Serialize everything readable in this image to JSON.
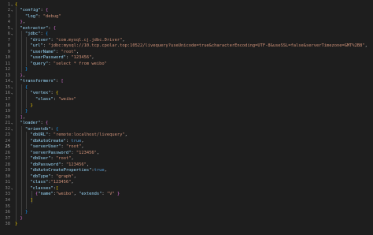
{
  "editor": {
    "lines": [
      {
        "n": "1",
        "segs": [
          [
            "{",
            "b1"
          ]
        ]
      },
      {
        "n": "2",
        "segs": [
          [
            "  ",
            ""
          ],
          [
            "\"config\"",
            "t-key"
          ],
          [
            ": ",
            "t-p"
          ],
          [
            "{",
            "b2"
          ]
        ]
      },
      {
        "n": "3",
        "segs": [
          [
            "    ",
            ""
          ],
          [
            "\"log\"",
            "t-key"
          ],
          [
            ": ",
            "t-p"
          ],
          [
            "\"debug\"",
            "t-str"
          ]
        ]
      },
      {
        "n": "4",
        "segs": [
          [
            "  ",
            ""
          ],
          [
            "}",
            "b2"
          ],
          [
            ",",
            "t-p"
          ]
        ]
      },
      {
        "n": "5",
        "segs": [
          [
            "  ",
            ""
          ],
          [
            "\"extractor\"",
            "t-key"
          ],
          [
            ": ",
            "t-p"
          ],
          [
            "{",
            "b2"
          ]
        ]
      },
      {
        "n": "6",
        "segs": [
          [
            "    ",
            ""
          ],
          [
            "\"jdbc\"",
            "t-key"
          ],
          [
            ": ",
            "t-p"
          ],
          [
            "{",
            "b3"
          ]
        ]
      },
      {
        "n": "7",
        "segs": [
          [
            "      ",
            ""
          ],
          [
            "\"driver\"",
            "t-key"
          ],
          [
            ": ",
            "t-p"
          ],
          [
            "\"com.mysql.cj.jdbc.Driver\"",
            "t-str"
          ],
          [
            ",",
            "t-p"
          ]
        ]
      },
      {
        "n": "8",
        "segs": [
          [
            "      ",
            ""
          ],
          [
            "\"url\"",
            "t-key"
          ],
          [
            ": ",
            "t-p"
          ],
          [
            "\"jdbc:mysql://10.tcp.cpolar.top:10522/livequery?useUnicode=true&characterEncoding=UTF-8&useSSL=false&serverTimezone=GMT%2B8\"",
            "t-str"
          ],
          [
            ",",
            "t-p"
          ]
        ]
      },
      {
        "n": "9",
        "segs": [
          [
            "      ",
            ""
          ],
          [
            "\"userName\"",
            "t-key"
          ],
          [
            ": ",
            "t-p"
          ],
          [
            "\"root\"",
            "t-str"
          ],
          [
            ",",
            "t-p"
          ]
        ]
      },
      {
        "n": "10",
        "segs": [
          [
            "      ",
            ""
          ],
          [
            "\"userPassword\"",
            "t-key"
          ],
          [
            ": ",
            "t-p"
          ],
          [
            "\"123456\"",
            "t-str"
          ],
          [
            ",",
            "t-p"
          ]
        ]
      },
      {
        "n": "11",
        "segs": [
          [
            "      ",
            ""
          ],
          [
            "\"query\"",
            "t-key"
          ],
          [
            ": ",
            "t-p"
          ],
          [
            "\"select * from weibo\"",
            "t-str"
          ]
        ]
      },
      {
        "n": "12",
        "segs": [
          [
            "    ",
            ""
          ],
          [
            "}",
            "b3"
          ]
        ]
      },
      {
        "n": "13",
        "segs": [
          [
            "  ",
            ""
          ],
          [
            "}",
            "b2"
          ],
          [
            ",",
            "t-p"
          ]
        ]
      },
      {
        "n": "14",
        "segs": [
          [
            "  ",
            ""
          ],
          [
            "\"transformers\"",
            "t-key"
          ],
          [
            ": ",
            "t-p"
          ],
          [
            "[",
            "b2"
          ]
        ]
      },
      {
        "n": "15",
        "segs": [
          [
            "    ",
            ""
          ],
          [
            "{",
            "b3"
          ]
        ]
      },
      {
        "n": "16",
        "segs": [
          [
            "      ",
            ""
          ],
          [
            "\"vertex\"",
            "t-key"
          ],
          [
            ": ",
            "t-p"
          ],
          [
            "{",
            "b1"
          ]
        ]
      },
      {
        "n": "17",
        "segs": [
          [
            "        ",
            ""
          ],
          [
            "\"class\"",
            "t-key"
          ],
          [
            ": ",
            "t-p"
          ],
          [
            "\"weibo\"",
            "t-str"
          ]
        ]
      },
      {
        "n": "18",
        "segs": [
          [
            "      ",
            ""
          ],
          [
            "}",
            "b1"
          ]
        ]
      },
      {
        "n": "19",
        "segs": [
          [
            "    ",
            ""
          ],
          [
            "}",
            "b3"
          ]
        ]
      },
      {
        "n": "20",
        "segs": [
          [
            "  ",
            ""
          ],
          [
            "]",
            "b2"
          ],
          [
            ",",
            "t-p"
          ]
        ]
      },
      {
        "n": "21",
        "segs": [
          [
            "  ",
            ""
          ],
          [
            "\"loader\"",
            "t-key"
          ],
          [
            ": ",
            "t-p"
          ],
          [
            "{",
            "b2"
          ]
        ]
      },
      {
        "n": "22",
        "segs": [
          [
            "    ",
            ""
          ],
          [
            "\"orientdb\"",
            "t-key"
          ],
          [
            ": ",
            "t-p"
          ],
          [
            "{",
            "b3"
          ]
        ]
      },
      {
        "n": "23",
        "segs": [
          [
            "      ",
            ""
          ],
          [
            "\"dbURL\"",
            "t-key"
          ],
          [
            ": ",
            "t-p"
          ],
          [
            "\"remote:localhost/livequery\"",
            "t-str"
          ],
          [
            ",",
            "t-p"
          ]
        ]
      },
      {
        "n": "24",
        "segs": [
          [
            "      ",
            ""
          ],
          [
            "\"dbAutoCreate\"",
            "t-key"
          ],
          [
            ": ",
            "t-p"
          ],
          [
            "true",
            "t-kw"
          ],
          [
            ",",
            "t-p"
          ]
        ]
      },
      {
        "n": "25",
        "segs": [
          [
            "      ",
            ""
          ],
          [
            "\"serverUser\"",
            "t-key"
          ],
          [
            ": ",
            "t-p"
          ],
          [
            "\"root\"",
            "t-str"
          ],
          [
            ",",
            "t-p"
          ]
        ]
      },
      {
        "n": "26",
        "segs": [
          [
            "      ",
            ""
          ],
          [
            "\"serverPassword\"",
            "t-key"
          ],
          [
            ": ",
            "t-p"
          ],
          [
            "\"123456\"",
            "t-str"
          ],
          [
            ",",
            "t-p"
          ]
        ]
      },
      {
        "n": "27",
        "segs": [
          [
            "      ",
            ""
          ],
          [
            "\"dbUser\"",
            "t-key"
          ],
          [
            ": ",
            "t-p"
          ],
          [
            "\"root\"",
            "t-str"
          ],
          [
            ",",
            "t-p"
          ]
        ]
      },
      {
        "n": "28",
        "segs": [
          [
            "      ",
            ""
          ],
          [
            "\"dbPassword\"",
            "t-key"
          ],
          [
            ": ",
            "t-p"
          ],
          [
            "\"123456\"",
            "t-str"
          ],
          [
            ",",
            "t-p"
          ]
        ]
      },
      {
        "n": "29",
        "segs": [
          [
            "      ",
            ""
          ],
          [
            "\"dbAutoCreateProperties\"",
            "t-key"
          ],
          [
            ":",
            "t-p"
          ],
          [
            "true",
            "t-kw"
          ],
          [
            ",",
            "t-p"
          ]
        ]
      },
      {
        "n": "30",
        "segs": [
          [
            "      ",
            ""
          ],
          [
            "\"dbType\"",
            "t-key"
          ],
          [
            ": ",
            "t-p"
          ],
          [
            "\"graph\"",
            "t-str"
          ],
          [
            ",",
            "t-p"
          ]
        ]
      },
      {
        "n": "31",
        "segs": [
          [
            "      ",
            ""
          ],
          [
            "\"class\"",
            "t-key"
          ],
          [
            ":",
            "t-p"
          ],
          [
            "\"123456\"",
            "t-str"
          ],
          [
            ",",
            "t-p"
          ]
        ]
      },
      {
        "n": "32",
        "segs": [
          [
            "      ",
            ""
          ],
          [
            "\"classes\"",
            "t-key"
          ],
          [
            ":",
            "t-p"
          ],
          [
            "[",
            "b1"
          ]
        ]
      },
      {
        "n": "33",
        "segs": [
          [
            "        ",
            ""
          ],
          [
            "{",
            "b2"
          ],
          [
            "\"name\"",
            "t-key"
          ],
          [
            ":",
            "t-p"
          ],
          [
            "\"weibo\"",
            "t-str"
          ],
          [
            ", ",
            "t-p"
          ],
          [
            "\"extends\"",
            "t-key"
          ],
          [
            ": ",
            "t-p"
          ],
          [
            "\"V\"",
            "t-str"
          ],
          [
            " ",
            ""
          ],
          [
            "}",
            "b2"
          ]
        ]
      },
      {
        "n": "34",
        "segs": [
          [
            "      ",
            ""
          ],
          [
            "]",
            "b1"
          ]
        ]
      },
      {
        "n": "35",
        "segs": []
      },
      {
        "n": "36",
        "segs": [
          [
            "    ",
            ""
          ],
          [
            "}",
            "b3"
          ]
        ]
      },
      {
        "n": "37",
        "segs": [
          [
            "  ",
            ""
          ],
          [
            "}",
            "b2"
          ]
        ]
      },
      {
        "n": "38",
        "segs": [
          [
            "}",
            "b1"
          ]
        ]
      }
    ],
    "active_line": "25",
    "folds": [
      "1",
      "2",
      "5",
      "6",
      "14",
      "15",
      "16",
      "21",
      "22",
      "32"
    ]
  },
  "colors": {
    "background": "#1e1e1e",
    "line_number": "#858585",
    "key": "#9cdcfe",
    "string": "#ce9178",
    "keyword": "#569cd6",
    "bracket_gold": "#ffd700",
    "bracket_purple": "#da70d6",
    "bracket_blue": "#179fff"
  },
  "icons": {
    "fold": "chevron-down-icon"
  }
}
